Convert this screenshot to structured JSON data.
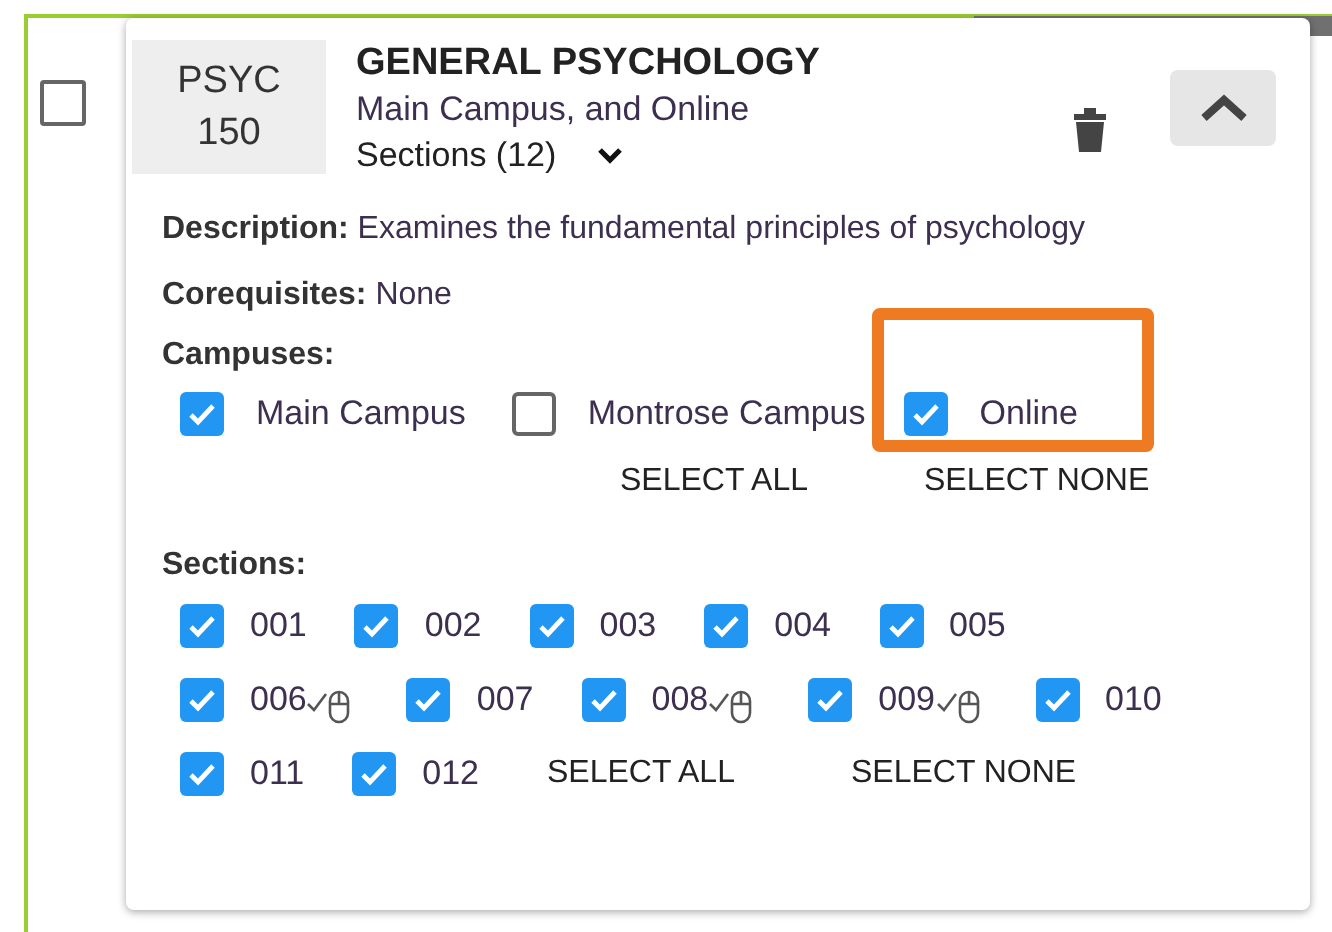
{
  "course": {
    "selected": false,
    "code_lines": [
      "PSYC",
      "150"
    ],
    "title": "GENERAL PSYCHOLOGY",
    "campuses_summary": "Main Campus, and Online",
    "sections_toggle": "Sections (12)",
    "expanded": true
  },
  "details": [
    {
      "label": "Description:",
      "value": "Examines the fundamental principles of psychology"
    },
    {
      "label": "Corequisites:",
      "value": "None"
    }
  ],
  "campuses": {
    "heading": "Campuses:",
    "items": [
      {
        "label": "Main Campus",
        "checked": true,
        "highlighted": false
      },
      {
        "label": "Montrose Campus",
        "checked": false,
        "highlighted": false
      },
      {
        "label": "Online",
        "checked": true,
        "highlighted": true
      }
    ],
    "select_all": "SELECT ALL",
    "select_none": "SELECT NONE"
  },
  "sections": {
    "heading": "Sections:",
    "items": [
      {
        "label": "001",
        "checked": true,
        "cursor": false
      },
      {
        "label": "002",
        "checked": true,
        "cursor": false
      },
      {
        "label": "003",
        "checked": true,
        "cursor": false
      },
      {
        "label": "004",
        "checked": true,
        "cursor": false
      },
      {
        "label": "005",
        "checked": true,
        "cursor": false
      },
      {
        "label": "006",
        "checked": true,
        "cursor": true
      },
      {
        "label": "007",
        "checked": true,
        "cursor": false
      },
      {
        "label": "008",
        "checked": true,
        "cursor": true
      },
      {
        "label": "009",
        "checked": true,
        "cursor": true
      },
      {
        "label": "010",
        "checked": true,
        "cursor": false
      },
      {
        "label": "011",
        "checked": true,
        "cursor": false
      },
      {
        "label": "012",
        "checked": true,
        "cursor": false
      }
    ],
    "select_all": "SELECT ALL",
    "select_none": "SELECT NONE"
  }
}
